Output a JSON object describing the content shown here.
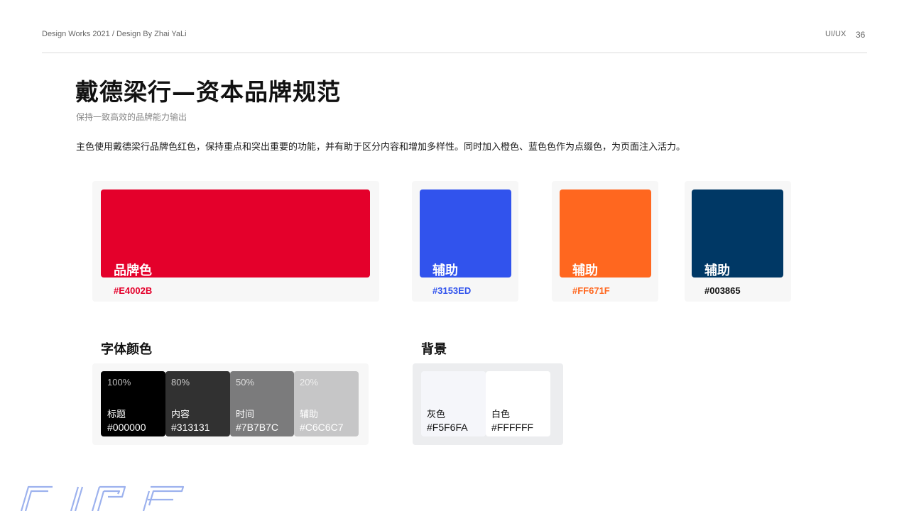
{
  "header": {
    "left_text": "Design Works 2021 / Design By Zhai YaLi",
    "right_text": "UI/UX",
    "page_number": "36"
  },
  "page": {
    "title": "戴德梁行—资本品牌规范",
    "subtitle": "保持一致高效的品牌能力输出",
    "description": "主色使用戴德梁行品牌色红色，保持重点和突出重要的功能，并有助于区分内容和增加多样性。同时加入橙色、蓝色色作为点缀色，为页面注入活力。"
  },
  "brand_colors": [
    {
      "label": "品牌色",
      "hex": "#E4002B",
      "color": "#E4002B",
      "hex_color": "#E4002B"
    },
    {
      "label": "辅助",
      "hex": "#3153ED",
      "color": "#3153ED",
      "hex_color": "#3153ED"
    },
    {
      "label": "辅助",
      "hex": "#FF671F",
      "color": "#FF671F",
      "hex_color": "#FF671F"
    },
    {
      "label": "辅助",
      "hex": "#003865",
      "color": "#003865",
      "hex_color": "#111111"
    }
  ],
  "font_colors": {
    "heading": "字体颜色",
    "tiles": [
      {
        "percent": "100%",
        "name": "标题",
        "hex": "#000000",
        "color": "#000000"
      },
      {
        "percent": "80%",
        "name": "内容",
        "hex": "#313131",
        "color": "#313131"
      },
      {
        "percent": "50%",
        "name": "时间",
        "hex": "#7B7B7C",
        "color": "#7B7B7C"
      },
      {
        "percent": "20%",
        "name": "辅助",
        "hex": "#C6C6C7",
        "color": "#C6C6C7"
      }
    ]
  },
  "backgrounds": {
    "heading": "背景",
    "tiles": [
      {
        "name": "灰色",
        "hex": "#F5F6FA",
        "color": "#F5F6FA"
      },
      {
        "name": "白色",
        "hex": "#FFFFFF",
        "color": "#FFFFFF"
      }
    ]
  },
  "watermark_text": "CIRE"
}
